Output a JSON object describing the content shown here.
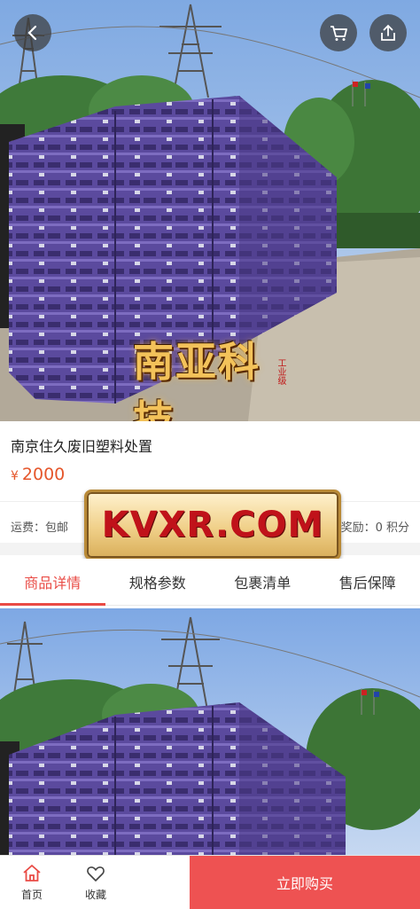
{
  "header": {
    "back_icon": "chevron-left-icon",
    "cart_icon": "cart-icon",
    "share_icon": "share-icon"
  },
  "hero": {
    "logo_text": "南亚科技",
    "logo_small_text": "工业级"
  },
  "product": {
    "title": "南京住久废旧塑料处置",
    "currency": "¥",
    "price": "2000",
    "shipping": "运费：包邮",
    "reward": "奖励：0 积分"
  },
  "watermark": {
    "text": "KVXR.COM"
  },
  "tabs": [
    {
      "label": "商品详情",
      "active": true
    },
    {
      "label": "规格参数",
      "active": false
    },
    {
      "label": "包裹清单",
      "active": false
    },
    {
      "label": "售后保障",
      "active": false
    }
  ],
  "bottom_bar": {
    "home_label": "首页",
    "favorite_label": "收藏",
    "buy_label": "立即购买"
  },
  "colors": {
    "accent": "#e94b45",
    "price": "#e5562b",
    "buy_button": "#ee5252",
    "pallet": "#5b4a9e"
  }
}
